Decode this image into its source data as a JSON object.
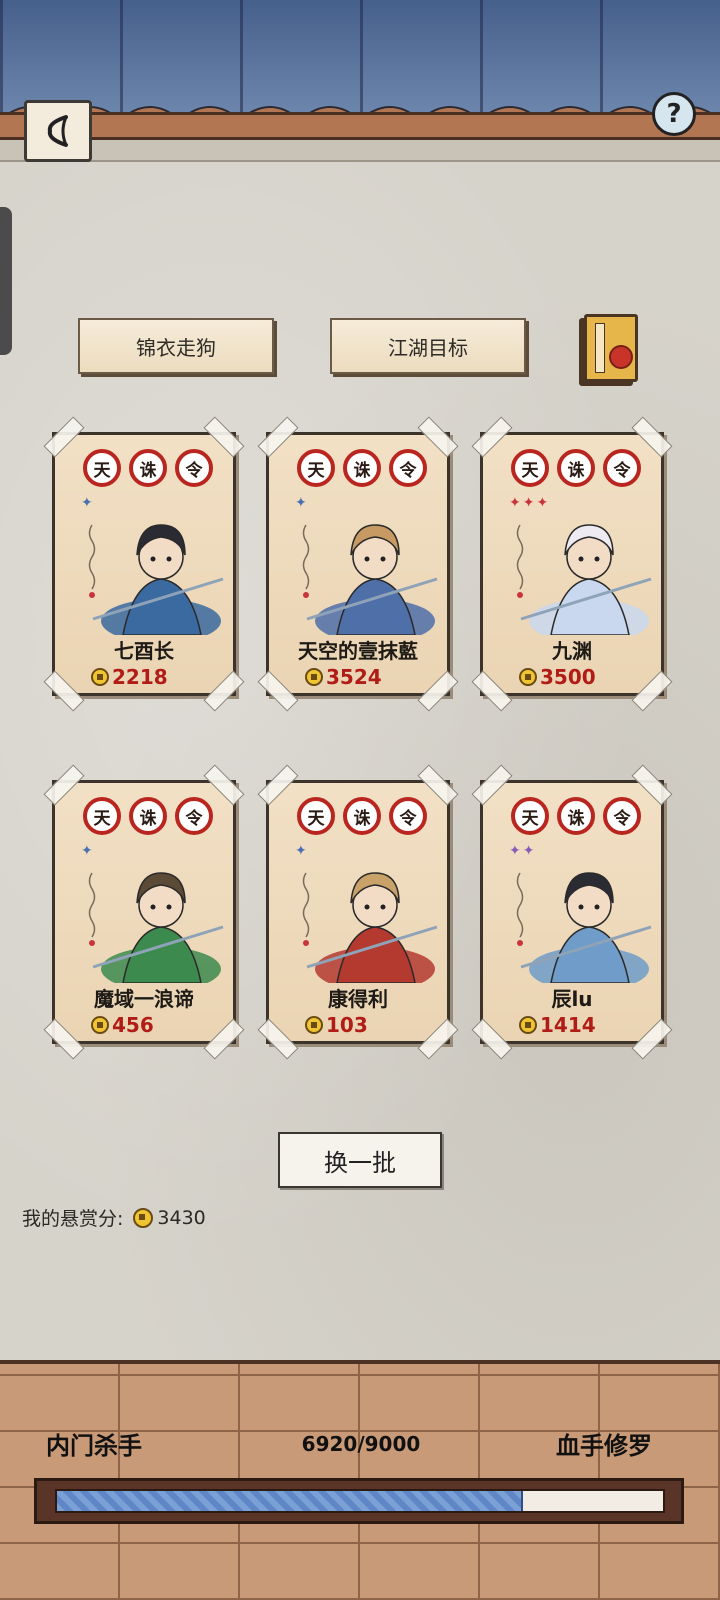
{
  "header": {
    "back_icon": "chevron-left-icon",
    "help_label": "?"
  },
  "tabs": [
    {
      "label": "锦衣走狗"
    },
    {
      "label": "江湖目标"
    }
  ],
  "book_icon": "bounty-book-icon",
  "cards": [
    {
      "badges": [
        "天",
        "诛",
        "令"
      ],
      "stars": "✦",
      "star_color": "#4a6fb5",
      "name": "七酉长",
      "bounty": "2218",
      "outfit": "#3a6aa0",
      "hair": "#2b2b33"
    },
    {
      "badges": [
        "天",
        "诛",
        "令"
      ],
      "stars": "✦",
      "star_color": "#4a6fb5",
      "name": "天空的壹抹藍",
      "bounty": "3524",
      "outfit": "#4f6fa8",
      "hair": "#c69a62"
    },
    {
      "badges": [
        "天",
        "诛",
        "令"
      ],
      "stars": "✦✦✦",
      "star_color": "#c8343a",
      "name": "九渊",
      "bounty": "3500",
      "outfit": "#c9d8ee",
      "hair": "#eeeaf1"
    },
    {
      "badges": [
        "天",
        "诛",
        "令"
      ],
      "stars": "✦",
      "star_color": "#4a6fb5",
      "name": "魔域一浪谛",
      "bounty": "456",
      "outfit": "#3d8a4f",
      "hair": "#5a4a36"
    },
    {
      "badges": [
        "天",
        "诛",
        "令"
      ],
      "stars": "✦",
      "star_color": "#4a6fb5",
      "name": "康得利",
      "bounty": "103",
      "outfit": "#b43a30",
      "hair": "#c9a26a"
    },
    {
      "badges": [
        "天",
        "诛",
        "令"
      ],
      "stars": "✦✦",
      "star_color": "#8a5ab8",
      "name": "辰lu",
      "bounty": "1414",
      "outfit": "#6f9cc8",
      "hair": "#2b2b33"
    }
  ],
  "refresh_label": "换一批",
  "my_bounty": {
    "label": "我的悬赏分:",
    "value": "3430"
  },
  "rank": {
    "current": "内门杀手",
    "next": "血手修罗",
    "progress_text": "6920/9000",
    "progress_fraction": 0.7689
  },
  "colors": {
    "accent_red": "#b01c16",
    "roof_blue": "#46608c",
    "progress_blue": "#5f87c5"
  }
}
